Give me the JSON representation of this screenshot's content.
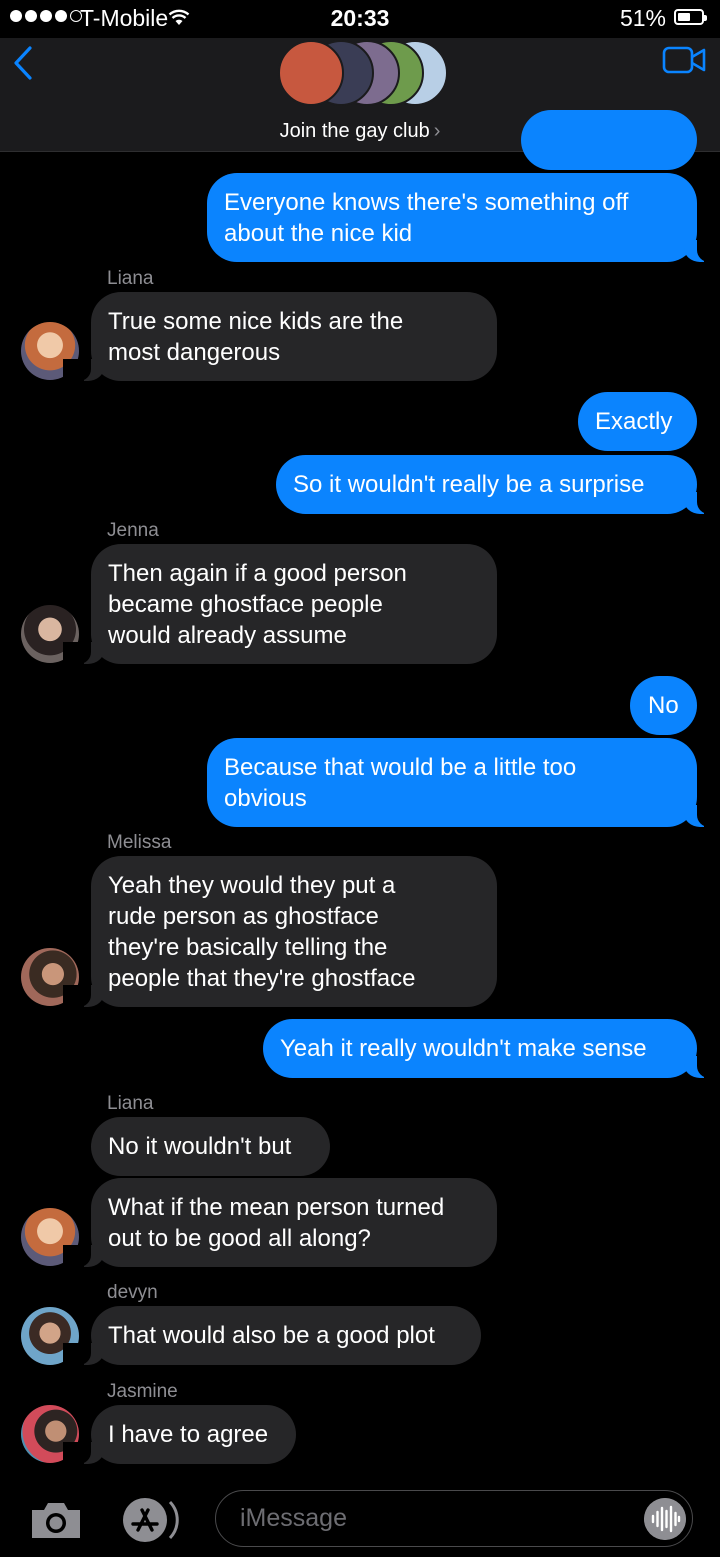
{
  "status_bar": {
    "carrier": "T-Mobile",
    "time": "20:33",
    "battery": "51%",
    "signal_bars_filled": 4,
    "signal_bars_total": 5
  },
  "header": {
    "group_name": "Join the gay club",
    "chevron": "›",
    "icons": [
      "back-chevron-icon",
      "video-camera-icon"
    ]
  },
  "messages": [
    {
      "from": "me",
      "text_lines": [
        "Everyone knows there's something off",
        "about the nice kid"
      ]
    },
    {
      "from": "Liana",
      "sender_label": "Liana",
      "text_lines": [
        "True some nice kids are the",
        "most dangerous"
      ]
    },
    {
      "from": "me",
      "text_lines": [
        "Exactly"
      ]
    },
    {
      "from": "me",
      "text_lines": [
        "So it wouldn't really be a surprise"
      ]
    },
    {
      "from": "Jenna",
      "sender_label": "Jenna",
      "text_lines": [
        "Then again if a good person",
        "became ghostface people",
        "would already assume"
      ]
    },
    {
      "from": "me",
      "text_lines": [
        "No"
      ]
    },
    {
      "from": "me",
      "text_lines": [
        "Because that would be a little too",
        "obvious"
      ]
    },
    {
      "from": "Melissa",
      "sender_label": "Melissa",
      "text_lines": [
        "Yeah they would they put a",
        "rude person as ghostface",
        "they're basically telling the",
        "people that they're ghostface"
      ]
    },
    {
      "from": "me",
      "text_lines": [
        "Yeah it really wouldn't make sense"
      ]
    },
    {
      "from": "Liana",
      "sender_label": "Liana",
      "text_lines": [
        "No it wouldn't but"
      ]
    },
    {
      "from": "Liana",
      "text_lines": [
        "What if the mean person turned",
        "out to be good all along?"
      ]
    },
    {
      "from": "devyn",
      "sender_label": "devyn",
      "text_lines": [
        "That would also be a good plot"
      ]
    },
    {
      "from": "Jasmine",
      "sender_label": "Jasmine",
      "text_lines": [
        "I have to agree"
      ]
    }
  ],
  "input_bar": {
    "placeholder": "iMessage",
    "icons": [
      "camera-icon",
      "app-store-icon",
      "audio-waveform-icon"
    ]
  },
  "colors": {
    "outgoing_bubble": "#0b84fe",
    "incoming_bubble": "#262628",
    "accent": "#0a84ff",
    "background": "#000000"
  }
}
